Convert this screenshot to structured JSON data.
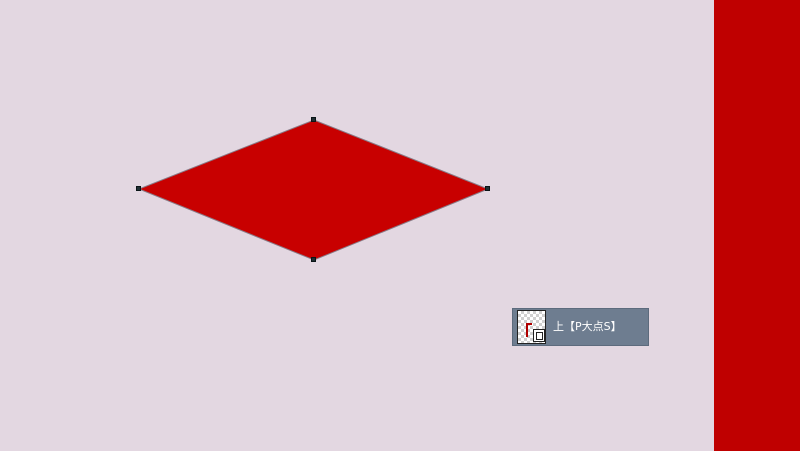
{
  "canvas": {
    "background_color": "#e3d7e1"
  },
  "right_panel": {
    "color": "#bf0000"
  },
  "shape": {
    "type": "diamond",
    "fill_color": "#c80000",
    "stroke_color": "#8a7a86",
    "anchor_color": "#1f2f33"
  },
  "layer_badge": {
    "label": "上【P大点S】",
    "thumbnail_icon": "layer-thumbnail-icon",
    "shape_icon": "vector-shape-icon",
    "background_color": "#6e7d90"
  }
}
